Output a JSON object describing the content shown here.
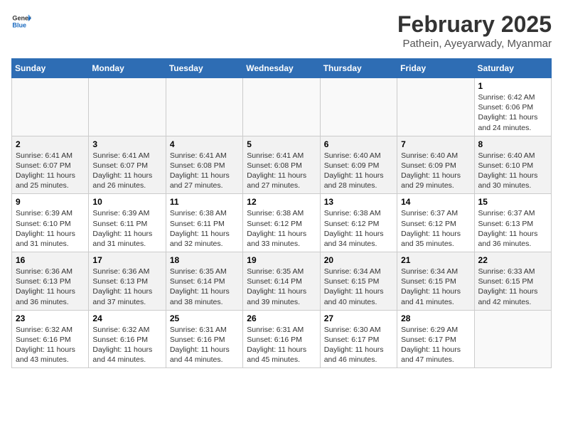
{
  "logo": {
    "general": "General",
    "blue": "Blue"
  },
  "header": {
    "month": "February 2025",
    "location": "Pathein, Ayeyarwady, Myanmar"
  },
  "weekdays": [
    "Sunday",
    "Monday",
    "Tuesday",
    "Wednesday",
    "Thursday",
    "Friday",
    "Saturday"
  ],
  "weeks": [
    [
      {
        "day": "",
        "info": ""
      },
      {
        "day": "",
        "info": ""
      },
      {
        "day": "",
        "info": ""
      },
      {
        "day": "",
        "info": ""
      },
      {
        "day": "",
        "info": ""
      },
      {
        "day": "",
        "info": ""
      },
      {
        "day": "1",
        "info": "Sunrise: 6:42 AM\nSunset: 6:06 PM\nDaylight: 11 hours and 24 minutes."
      }
    ],
    [
      {
        "day": "2",
        "info": "Sunrise: 6:41 AM\nSunset: 6:07 PM\nDaylight: 11 hours and 25 minutes."
      },
      {
        "day": "3",
        "info": "Sunrise: 6:41 AM\nSunset: 6:07 PM\nDaylight: 11 hours and 26 minutes."
      },
      {
        "day": "4",
        "info": "Sunrise: 6:41 AM\nSunset: 6:08 PM\nDaylight: 11 hours and 27 minutes."
      },
      {
        "day": "5",
        "info": "Sunrise: 6:41 AM\nSunset: 6:08 PM\nDaylight: 11 hours and 27 minutes."
      },
      {
        "day": "6",
        "info": "Sunrise: 6:40 AM\nSunset: 6:09 PM\nDaylight: 11 hours and 28 minutes."
      },
      {
        "day": "7",
        "info": "Sunrise: 6:40 AM\nSunset: 6:09 PM\nDaylight: 11 hours and 29 minutes."
      },
      {
        "day": "8",
        "info": "Sunrise: 6:40 AM\nSunset: 6:10 PM\nDaylight: 11 hours and 30 minutes."
      }
    ],
    [
      {
        "day": "9",
        "info": "Sunrise: 6:39 AM\nSunset: 6:10 PM\nDaylight: 11 hours and 31 minutes."
      },
      {
        "day": "10",
        "info": "Sunrise: 6:39 AM\nSunset: 6:11 PM\nDaylight: 11 hours and 31 minutes."
      },
      {
        "day": "11",
        "info": "Sunrise: 6:38 AM\nSunset: 6:11 PM\nDaylight: 11 hours and 32 minutes."
      },
      {
        "day": "12",
        "info": "Sunrise: 6:38 AM\nSunset: 6:12 PM\nDaylight: 11 hours and 33 minutes."
      },
      {
        "day": "13",
        "info": "Sunrise: 6:38 AM\nSunset: 6:12 PM\nDaylight: 11 hours and 34 minutes."
      },
      {
        "day": "14",
        "info": "Sunrise: 6:37 AM\nSunset: 6:12 PM\nDaylight: 11 hours and 35 minutes."
      },
      {
        "day": "15",
        "info": "Sunrise: 6:37 AM\nSunset: 6:13 PM\nDaylight: 11 hours and 36 minutes."
      }
    ],
    [
      {
        "day": "16",
        "info": "Sunrise: 6:36 AM\nSunset: 6:13 PM\nDaylight: 11 hours and 36 minutes."
      },
      {
        "day": "17",
        "info": "Sunrise: 6:36 AM\nSunset: 6:13 PM\nDaylight: 11 hours and 37 minutes."
      },
      {
        "day": "18",
        "info": "Sunrise: 6:35 AM\nSunset: 6:14 PM\nDaylight: 11 hours and 38 minutes."
      },
      {
        "day": "19",
        "info": "Sunrise: 6:35 AM\nSunset: 6:14 PM\nDaylight: 11 hours and 39 minutes."
      },
      {
        "day": "20",
        "info": "Sunrise: 6:34 AM\nSunset: 6:15 PM\nDaylight: 11 hours and 40 minutes."
      },
      {
        "day": "21",
        "info": "Sunrise: 6:34 AM\nSunset: 6:15 PM\nDaylight: 11 hours and 41 minutes."
      },
      {
        "day": "22",
        "info": "Sunrise: 6:33 AM\nSunset: 6:15 PM\nDaylight: 11 hours and 42 minutes."
      }
    ],
    [
      {
        "day": "23",
        "info": "Sunrise: 6:32 AM\nSunset: 6:16 PM\nDaylight: 11 hours and 43 minutes."
      },
      {
        "day": "24",
        "info": "Sunrise: 6:32 AM\nSunset: 6:16 PM\nDaylight: 11 hours and 44 minutes."
      },
      {
        "day": "25",
        "info": "Sunrise: 6:31 AM\nSunset: 6:16 PM\nDaylight: 11 hours and 44 minutes."
      },
      {
        "day": "26",
        "info": "Sunrise: 6:31 AM\nSunset: 6:16 PM\nDaylight: 11 hours and 45 minutes."
      },
      {
        "day": "27",
        "info": "Sunrise: 6:30 AM\nSunset: 6:17 PM\nDaylight: 11 hours and 46 minutes."
      },
      {
        "day": "28",
        "info": "Sunrise: 6:29 AM\nSunset: 6:17 PM\nDaylight: 11 hours and 47 minutes."
      },
      {
        "day": "",
        "info": ""
      }
    ]
  ]
}
